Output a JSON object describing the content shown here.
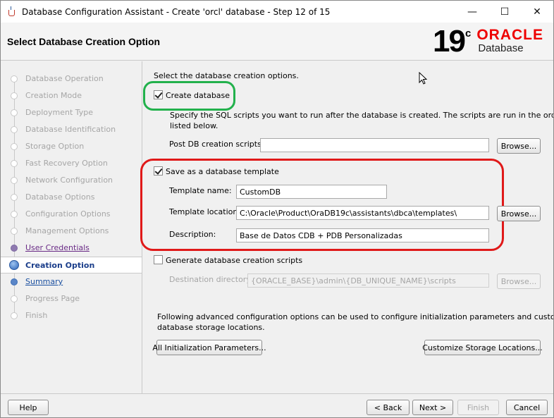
{
  "window": {
    "title": "Database Configuration Assistant - Create 'orcl' database - Step 12 of 15",
    "minimize_glyph": "—",
    "maximize_glyph": "☐",
    "close_glyph": "✕"
  },
  "header": {
    "title": "Select Database Creation Option",
    "logo_version": "19",
    "logo_suffix": "c",
    "logo_brand": "ORACLE",
    "logo_product": "Database"
  },
  "nav": {
    "items": [
      {
        "label": "Database Operation",
        "state": "disabled"
      },
      {
        "label": "Creation Mode",
        "state": "disabled"
      },
      {
        "label": "Deployment Type",
        "state": "disabled"
      },
      {
        "label": "Database Identification",
        "state": "disabled"
      },
      {
        "label": "Storage Option",
        "state": "disabled"
      },
      {
        "label": "Fast Recovery Option",
        "state": "disabled"
      },
      {
        "label": "Network Configuration",
        "state": "disabled"
      },
      {
        "label": "Database Options",
        "state": "disabled"
      },
      {
        "label": "Configuration Options",
        "state": "disabled"
      },
      {
        "label": "Management Options",
        "state": "disabled"
      },
      {
        "label": "User Credentials",
        "state": "visited"
      },
      {
        "label": "Creation Option",
        "state": "current"
      },
      {
        "label": "Summary",
        "state": "next"
      },
      {
        "label": "Progress Page",
        "state": "disabled"
      },
      {
        "label": "Finish",
        "state": "disabled"
      }
    ]
  },
  "main": {
    "intro": "Select the database creation options.",
    "create_database": {
      "label": "Create database",
      "checked": true,
      "desc_line1": "Specify the SQL scripts you want to run after the database is created. The scripts are run in the order",
      "desc_line2": "listed below.",
      "post_scripts_label": "Post DB creation scripts:",
      "post_scripts_value": "",
      "browse_label": "Browse..."
    },
    "save_template": {
      "label": "Save as a database template",
      "checked": true,
      "name_label": "Template name:",
      "name_value": "CustomDB",
      "location_label": "Template location:",
      "location_value": "C:\\Oracle\\Product\\OraDB19c\\assistants\\dbca\\templates\\",
      "browse_label": "Browse...",
      "description_label": "Description:",
      "description_value": "Base de Datos CDB + PDB Personalizadas"
    },
    "generate_scripts": {
      "label": "Generate database creation scripts",
      "checked": false,
      "destination_label": "Destination directory:",
      "destination_value": "{ORACLE_BASE}\\admin\\{DB_UNIQUE_NAME}\\scripts",
      "browse_label": "Browse..."
    },
    "advanced_line1": "Following advanced configuration options can be used to configure initialization parameters and customize",
    "advanced_line2": "database storage locations.",
    "init_params_button": "All Initialization Parameters...",
    "customize_storage_button": "Customize Storage Locations..."
  },
  "footer": {
    "help": "Help",
    "back": "< Back",
    "next": "Next >",
    "finish": "Finish",
    "cancel": "Cancel"
  },
  "colors": {
    "highlight_green": "#22b14c",
    "highlight_red": "#e01919",
    "oracle_red": "#ee0000"
  }
}
